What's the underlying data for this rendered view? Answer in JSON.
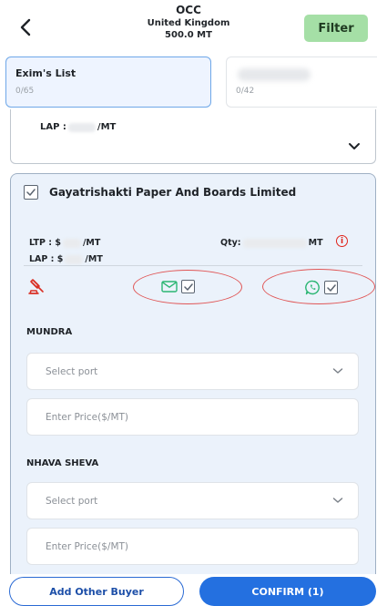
{
  "header": {
    "title": "OCC",
    "country": "United Kingdom",
    "quantity": "500.0 MT",
    "filter_label": "Filter"
  },
  "tabs": [
    {
      "label": "Exim's List",
      "count": "0/65",
      "active": true
    },
    {
      "label": "",
      "count": "0/42",
      "active": false
    }
  ],
  "previous_card": {
    "lap_label": "LAP :",
    "lap_unit": "/MT"
  },
  "buyer": {
    "name": "Gayatrishakti Paper And Boards Limited",
    "ltp_label": "LTP : $",
    "ltp_unit": "/MT",
    "lap_label": "LAP : $",
    "lap_unit": "/MT",
    "qty_label": "Qty:",
    "qty_unit": "MT",
    "info_glyph": "i",
    "email_checked": true,
    "whatsapp_checked": true
  },
  "ports": [
    {
      "name": "MUNDRA",
      "select_placeholder": "Select port",
      "price_placeholder": "Enter Price($/MT)"
    },
    {
      "name": "NHAVA SHEVA",
      "select_placeholder": "Select port",
      "price_placeholder": "Enter Price($/MT)"
    }
  ],
  "footer": {
    "add_buyer_label": "Add Other Buyer",
    "confirm_label": "CONFIRM (1)"
  },
  "colors": {
    "primary": "#2470e0",
    "filter_bg": "#a5dfa6",
    "highlight_oval": "#e05656",
    "card_bg": "#ebf2fb",
    "email_icon": "#2bb673",
    "whatsapp_icon": "#2bb673",
    "gavel_icon": "#d93025"
  },
  "icons": [
    "back-arrow-icon",
    "chevron-down-icon",
    "checkbox-icon",
    "info-icon",
    "gavel-icon",
    "email-icon",
    "whatsapp-icon"
  ]
}
